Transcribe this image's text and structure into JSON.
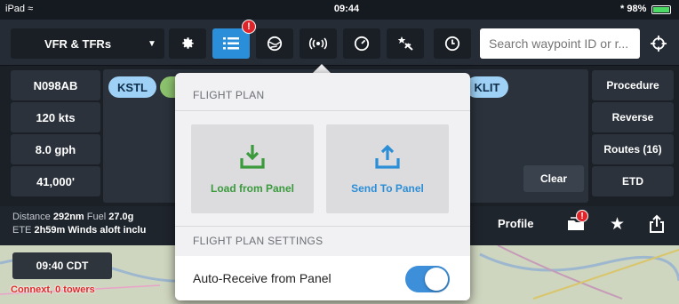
{
  "status_bar": {
    "device": "iPad",
    "time": "09:44",
    "battery": "98%",
    "battery_level": 0.98
  },
  "toolbar": {
    "layer_select": "VFR & TFRs",
    "search_placeholder": "Search waypoint ID or r...",
    "flightplan_badge": "!",
    "icons": [
      "gear-icon",
      "flight-plan-list-icon",
      "globe-icon",
      "connext-icon",
      "gauge-icon",
      "star-plane-icon",
      "clock-icon",
      "target-icon"
    ]
  },
  "flight_plan": {
    "left": [
      "N098AB",
      "120 kts",
      "8.0 gph",
      "41,000'"
    ],
    "route": [
      "KSTL",
      "KLIT"
    ],
    "clear": "Clear",
    "right": [
      "Procedure",
      "Reverse",
      "Routes (16)",
      "ETD"
    ]
  },
  "info_bar": {
    "distance_label": "Distance",
    "distance_value": "292nm",
    "fuel_label": "Fuel",
    "fuel_value": "27.0g",
    "ete_label": "ETE",
    "ete_value": "2h59m",
    "winds_text": "Winds aloft inclu",
    "profile": "Profile",
    "files_badge": "!"
  },
  "map": {
    "time": "09:40 CDT",
    "towers": "Connext, 0 towers"
  },
  "popover": {
    "section1": "FLIGHT PLAN",
    "load_label": "Load from Panel",
    "send_label": "Send To Panel",
    "section2": "FLIGHT PLAN SETTINGS",
    "auto_receive_label": "Auto-Receive from Panel",
    "auto_receive_on": true,
    "colors": {
      "load": "#3a9a3c",
      "send": "#2c8ed6",
      "toggle_on": "#3d8fd9"
    }
  }
}
